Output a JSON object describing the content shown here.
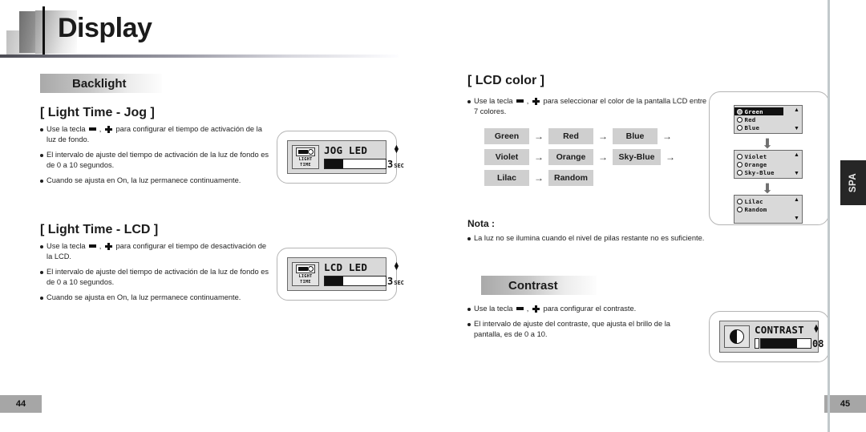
{
  "header": {
    "title": "Display"
  },
  "left_page": {
    "section_heading": "Backlight",
    "page_number": "44",
    "blocks": [
      {
        "title": "[ Light Time - Jog ]",
        "bullets": [
          "Use la tecla ▬ , ✚ para configurar el tiempo de activación de la luz de fondo.",
          "El intervalo de ajuste del tiempo de activación de la luz de fondo es de 0 a 10 segundos.",
          "Cuando se ajusta en On, la luz permanece continuamente."
        ],
        "device": {
          "icon_label_line1": "LIGHT",
          "icon_label_line2": "TIME",
          "title": "JOG LED",
          "value": "3",
          "unit": "SEC",
          "fill_percent": 30
        }
      },
      {
        "title": "[ Light Time - LCD ]",
        "bullets": [
          "Use la tecla ▬ , ✚  para configurar el tiempo de desactivación de la LCD.",
          "El intervalo de ajuste del tiempo de activación de la luz de fondo es de 0 a 10 segundos.",
          "Cuando se ajusta en On, la luz permanece continuamente."
        ],
        "device": {
          "icon_label_line1": "LIGHT",
          "icon_label_line2": "TIME",
          "title": "LCD LED",
          "value": "3",
          "unit": "SEC",
          "fill_percent": 30
        }
      }
    ]
  },
  "right_page": {
    "page_number": "45",
    "side_tab": "SPA",
    "lcd_color": {
      "title": "[ LCD color ]",
      "bullets": [
        "Use la tecla ▬ , ✚ para seleccionar el color de la pantalla LCD entre 7 colores."
      ],
      "chip_rows": [
        [
          "Green",
          "Red",
          "Blue"
        ],
        [
          "Violet",
          "Orange",
          "Sky-Blue"
        ],
        [
          "Lilac",
          "Random"
        ]
      ],
      "chip_arrow": "→",
      "row_trailing_arrow": [
        "→",
        "→",
        ""
      ],
      "selector_boxes": [
        {
          "items": [
            {
              "label": "Green",
              "selected": true
            },
            {
              "label": "Red",
              "selected": false
            },
            {
              "label": "Blue",
              "selected": false
            }
          ],
          "scroll_up": "▲",
          "scroll_down": "▼"
        },
        {
          "items": [
            {
              "label": "Violet",
              "selected": false
            },
            {
              "label": "Orange",
              "selected": false
            },
            {
              "label": "Sky-Blue",
              "selected": false
            }
          ],
          "scroll_up": "▲",
          "scroll_down": "▼"
        },
        {
          "items": [
            {
              "label": "Lilac",
              "selected": false
            },
            {
              "label": "Random",
              "selected": false
            }
          ],
          "scroll_up": "▲",
          "scroll_down": "▼"
        }
      ],
      "flow_arrow": "⬇"
    },
    "note": {
      "title": "Nota :",
      "bullets": [
        "La luz no se ilumina cuando el nivel de pilas restante no es suficiente."
      ]
    },
    "contrast": {
      "section_heading": "Contrast",
      "bullets": [
        "Use la tecla ▬ , ✚ para configurar el contraste.",
        "El intervalo de ajuste del contraste, que ajusta el brillo de la pantalla, es de 0 a 10."
      ],
      "device": {
        "title": "CONTRAST",
        "value": "08",
        "fill_percent": 72
      }
    }
  },
  "ui_colors": {
    "chip_bg": "#cfcfcf",
    "lcd_bg": "#d9d9d9",
    "page_badge_bg": "#a6a6a6",
    "side_tab_bg": "#262626"
  }
}
